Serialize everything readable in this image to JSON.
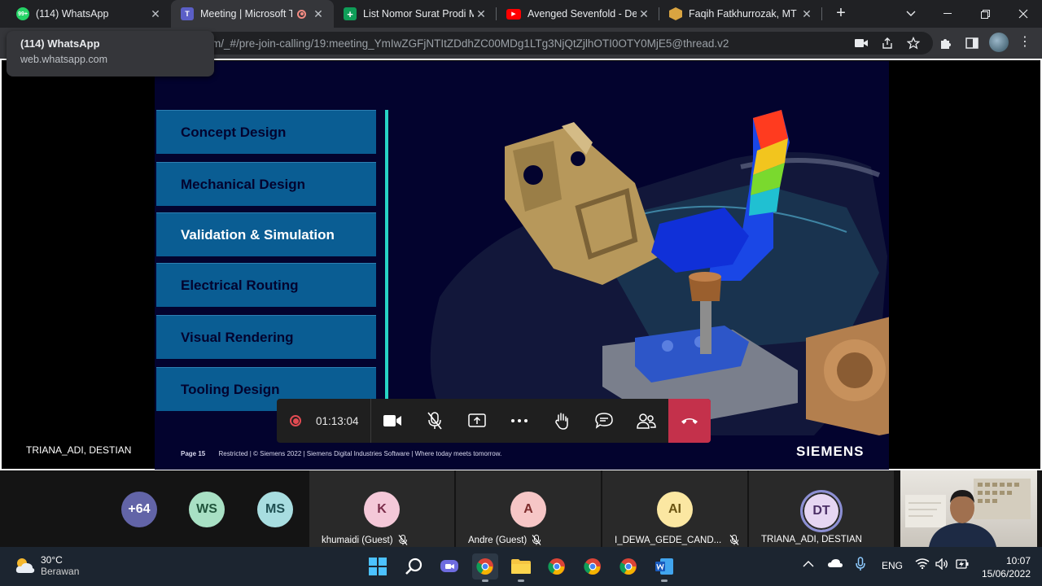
{
  "browser": {
    "tabs": [
      {
        "title": "(114) WhatsApp",
        "favicon": "whatsapp-icon",
        "badge": "99+"
      },
      {
        "title": "Meeting | Microsoft Te",
        "favicon": "teams-icon",
        "active": true,
        "recording": true
      },
      {
        "title": "List Nomor Surat Prodi M",
        "favicon": "sheets-icon"
      },
      {
        "title": "Avenged Sevenfold - Dea",
        "favicon": "youtube-icon"
      },
      {
        "title": "Faqih Fatkhurrozak, MT | S",
        "favicon": "hexagon-icon"
      }
    ],
    "url": "m/_#/pre-join-calling/19:meeting_YmIwZGFjNTItZDdhZC00MDg1LTg3NjQtZjlhOTI0OTY0MjE5@thread.v2",
    "tooltip": {
      "title": "(114) WhatsApp",
      "domain": "web.whatsapp.com"
    }
  },
  "slide": {
    "menu": [
      {
        "label": "Concept Design",
        "active": false
      },
      {
        "label": "Mechanical Design",
        "active": false
      },
      {
        "label": "Validation & Simulation",
        "active": true
      },
      {
        "label": "Electrical Routing",
        "active": false
      },
      {
        "label": "Visual Rendering",
        "active": false
      },
      {
        "label": "Tooling Design",
        "active": false
      }
    ],
    "page": "Page 15",
    "footer": "Restricted | © Siemens 2022 | Siemens Digital Industries Software | Where today meets tomorrow.",
    "logo": "SIEMENS"
  },
  "stage": {
    "presenter_name": "TRIANA_ADI, DESTIAN"
  },
  "controls": {
    "timer": "01:13:04"
  },
  "participants": {
    "bubbles": [
      {
        "initials": "+64",
        "bg": "#6264a7",
        "fg": "#ffffff"
      },
      {
        "initials": "WS",
        "bg": "#a8e0c4",
        "fg": "#20543b"
      },
      {
        "initials": "MS",
        "bg": "#a8dde0",
        "fg": "#1f4f52"
      }
    ],
    "tiles": [
      {
        "initials": "K",
        "name": "khumaidi (Guest)",
        "bg": "#f4c8d8",
        "fg": "#7a2c49"
      },
      {
        "initials": "A",
        "name": "Andre (Guest)",
        "bg": "#f6c6c6",
        "fg": "#7c2b2b"
      },
      {
        "initials": "AI",
        "name": "I_DEWA_GEDE_CAND...",
        "bg": "#fbe7a2",
        "fg": "#6a5312"
      },
      {
        "initials": "DT",
        "name": "TRIANA_ADI, DESTIAN",
        "bg": "#e6d6f2",
        "fg": "#4b2f66"
      }
    ]
  },
  "taskbar": {
    "weather_temp": "30°C",
    "weather_desc": "Berawan",
    "lang": "ENG",
    "time": "10:07",
    "date": "15/06/2022"
  }
}
